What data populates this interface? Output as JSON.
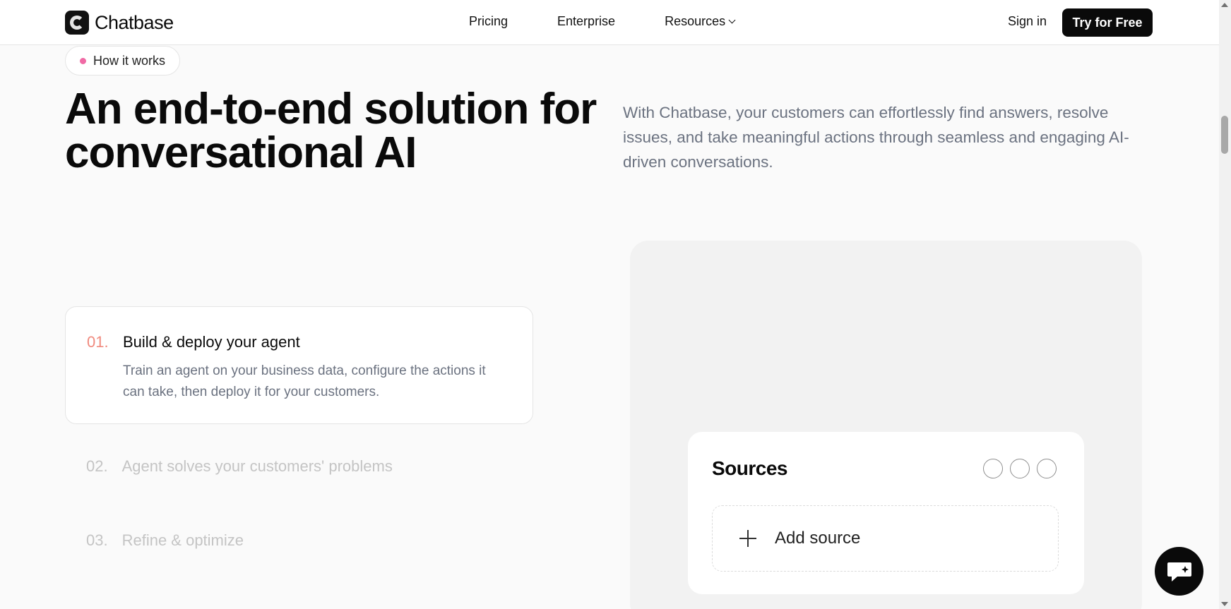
{
  "nav": {
    "brand": "Chatbase",
    "links": [
      "Pricing",
      "Enterprise",
      "Resources"
    ],
    "sign_in": "Sign in",
    "cta": "Try for Free"
  },
  "badge": {
    "label": "How it works",
    "dot_color": "#f06aa5"
  },
  "hero": {
    "title": "An end-to-end solution for conversational AI",
    "description": "With Chatbase, your customers can effortlessly find answers, resolve issues, and take meaningful actions through seamless and engaging AI-driven conversations."
  },
  "steps": [
    {
      "num": "01.",
      "title": "Build & deploy your agent",
      "body": "Train an agent on your business data, configure the actions it can take, then deploy it for your customers.",
      "active": true
    },
    {
      "num": "02.",
      "title": "Agent solves your customers' problems",
      "active": false
    },
    {
      "num": "03.",
      "title": "Refine & optimize",
      "active": false
    }
  ],
  "sources_card": {
    "title": "Sources",
    "add_label": "Add source"
  },
  "colors": {
    "accent": "#f08a7e",
    "muted_text": "#6b7280",
    "primary": "#0a0a0a"
  }
}
